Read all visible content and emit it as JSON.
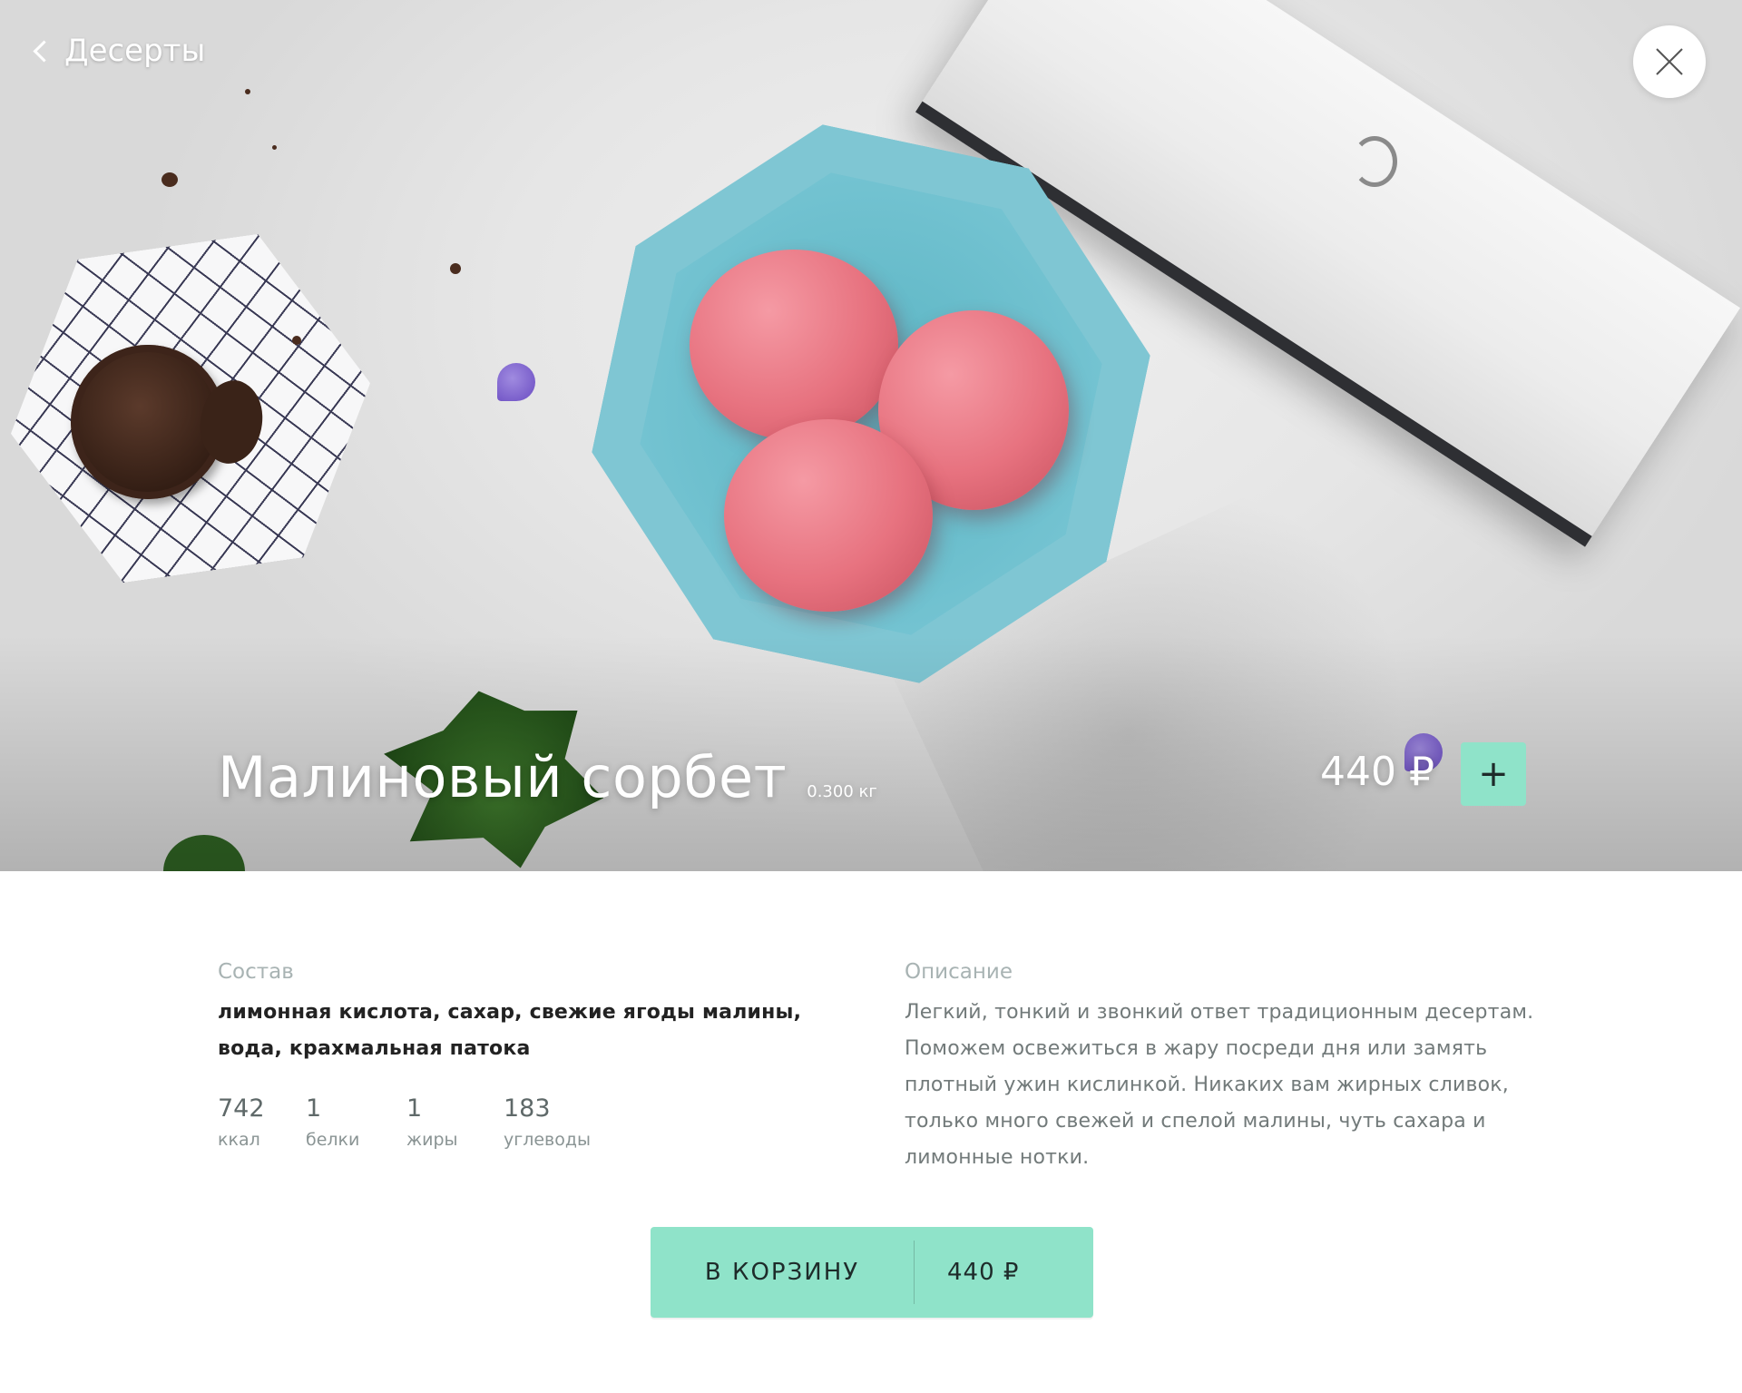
{
  "header": {
    "back_label": "Десерты"
  },
  "product": {
    "title": "Малиновый сорбет",
    "weight": "0.300 кг",
    "price": "440 ₽",
    "add_label": "+"
  },
  "details": {
    "ingredients_title": "Состав",
    "ingredients_text": "лимонная кислота, сахар, свежие ягоды малины, вода, крахмальная патока",
    "description_title": "Описание",
    "description_text": "Легкий, тонкий и звонкий ответ традиционным десертам. Поможем освежиться в жару посреди дня или замять плотный ужин кислинкой. Никаких вам жирных сливок, только много свежей и спелой малины, чуть сахара и лимонные нотки.",
    "nutrition": [
      {
        "value": "742",
        "unit": "ккал"
      },
      {
        "value": "1",
        "unit": "белки"
      },
      {
        "value": "1",
        "unit": "жиры"
      },
      {
        "value": "183",
        "unit": "углеводы"
      }
    ]
  },
  "cart": {
    "label": "В КОРЗИНУ",
    "price": "440 ₽"
  },
  "colors": {
    "accent": "#8fe3c9",
    "muted_label": "#a8b3b3",
    "text_dark": "#222222",
    "text_muted": "#727a7a"
  },
  "icons": {
    "back": "chevron-left-icon",
    "close": "close-icon"
  }
}
